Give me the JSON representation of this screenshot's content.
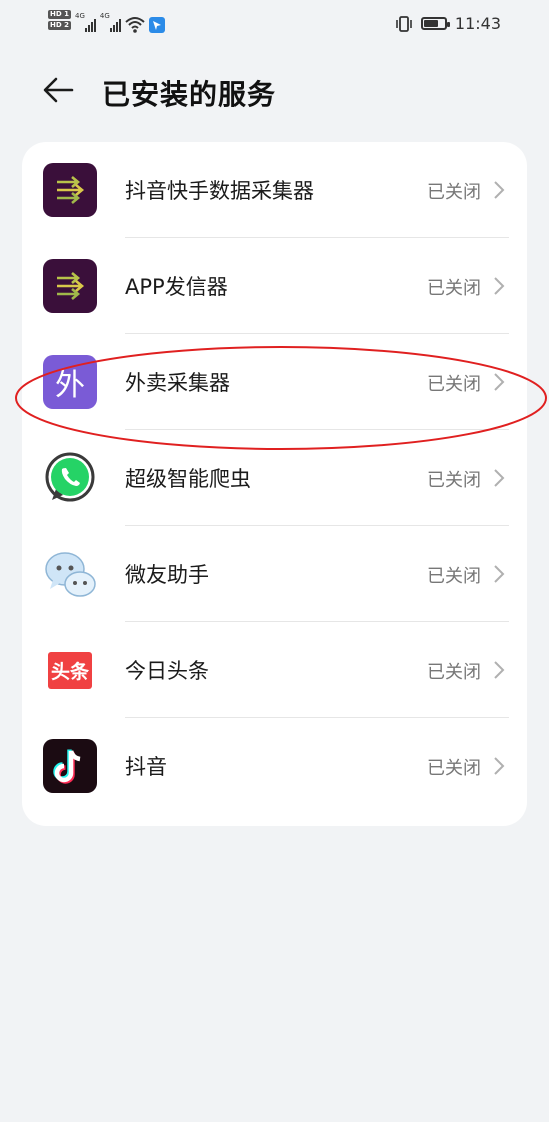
{
  "status_bar": {
    "time": "11:43",
    "network_a": "4G",
    "network_b": "4G",
    "battery_level": 0.7
  },
  "header": {
    "title": "已安装的服务"
  },
  "services": [
    {
      "name": "抖音快手数据采集器",
      "status": "已关闭",
      "icon": "arrows-purple-icon"
    },
    {
      "name": "APP发信器",
      "status": "已关闭",
      "icon": "arrows-purple-icon"
    },
    {
      "name": "外卖采集器",
      "status": "已关闭",
      "icon": "wai-char-icon",
      "icon_text": "外"
    },
    {
      "name": "超级智能爬虫",
      "status": "已关闭",
      "icon": "whatsapp-icon"
    },
    {
      "name": "微友助手",
      "status": "已关闭",
      "icon": "chat-bubbles-icon"
    },
    {
      "name": "今日头条",
      "status": "已关闭",
      "icon": "toutiao-icon",
      "icon_text": "头条"
    },
    {
      "name": "抖音",
      "status": "已关闭",
      "icon": "tiktok-icon"
    }
  ],
  "colors": {
    "accent_red_outline": "#e02020",
    "dark_purple": "#3a0f3a",
    "wai_purple": "#7a5bd6"
  }
}
